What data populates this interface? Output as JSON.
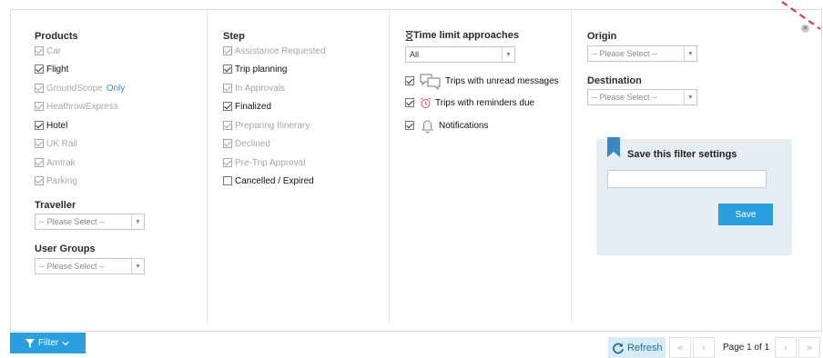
{
  "products": {
    "title": "Products",
    "items": [
      {
        "label": "Car",
        "checked": true,
        "enabled": false
      },
      {
        "label": "Flight",
        "checked": true,
        "enabled": true
      },
      {
        "label": "GroundScope",
        "suffix": "Only",
        "checked": true,
        "enabled": false
      },
      {
        "label": "HeathrowExpress",
        "checked": true,
        "enabled": false
      },
      {
        "label": "Hotel",
        "checked": true,
        "enabled": true
      },
      {
        "label": "UK Rail",
        "checked": true,
        "enabled": false
      },
      {
        "label": "Amtrak",
        "checked": true,
        "enabled": false
      },
      {
        "label": "Parking",
        "checked": true,
        "enabled": false
      }
    ]
  },
  "traveller": {
    "title": "Traveller",
    "placeholder": "-- Please Select --"
  },
  "user_groups": {
    "title": "User Groups",
    "placeholder": "-- Please Select --"
  },
  "step": {
    "title": "Step",
    "items": [
      {
        "label": "Assistance Requested",
        "checked": true,
        "enabled": false
      },
      {
        "label": "Trip planning",
        "checked": true,
        "enabled": true
      },
      {
        "label": "In Approvals",
        "checked": true,
        "enabled": false
      },
      {
        "label": "Finalized",
        "checked": true,
        "enabled": true
      },
      {
        "label": "Preparing Itinerary",
        "checked": true,
        "enabled": false
      },
      {
        "label": "Declined",
        "checked": true,
        "enabled": false
      },
      {
        "label": "Pre-Trip Approval",
        "checked": true,
        "enabled": false
      },
      {
        "label": "Cancelled / Expired",
        "checked": false,
        "enabled": true
      }
    ]
  },
  "time_limit": {
    "title": "Time limit approaches",
    "select_value": "All",
    "items": [
      {
        "label": "Trips with unread messages",
        "checked": true,
        "icon": "message-icon"
      },
      {
        "label": "Trips with reminders due",
        "checked": true,
        "icon": "alarm-clock-icon"
      },
      {
        "label": "Notifications",
        "checked": true,
        "icon": "bell-icon"
      }
    ]
  },
  "origin": {
    "title": "Origin",
    "placeholder": "-- Please Select --"
  },
  "destination": {
    "title": "Destination",
    "placeholder": "-- Please Select --"
  },
  "save_filter": {
    "title": "Save this filter settings",
    "input_value": "",
    "button_label": "Save"
  },
  "footer": {
    "filter_label": "Filter",
    "refresh_label": "Refresh",
    "first_label": "«",
    "prev_label": "‹",
    "page_label": "Page 1 of 1",
    "next_label": "›",
    "last_label": "»"
  },
  "colors": {
    "accent": "#2b9ee0",
    "panel_bg": "#e7eef3",
    "disabled_text": "#a6a6a6"
  }
}
